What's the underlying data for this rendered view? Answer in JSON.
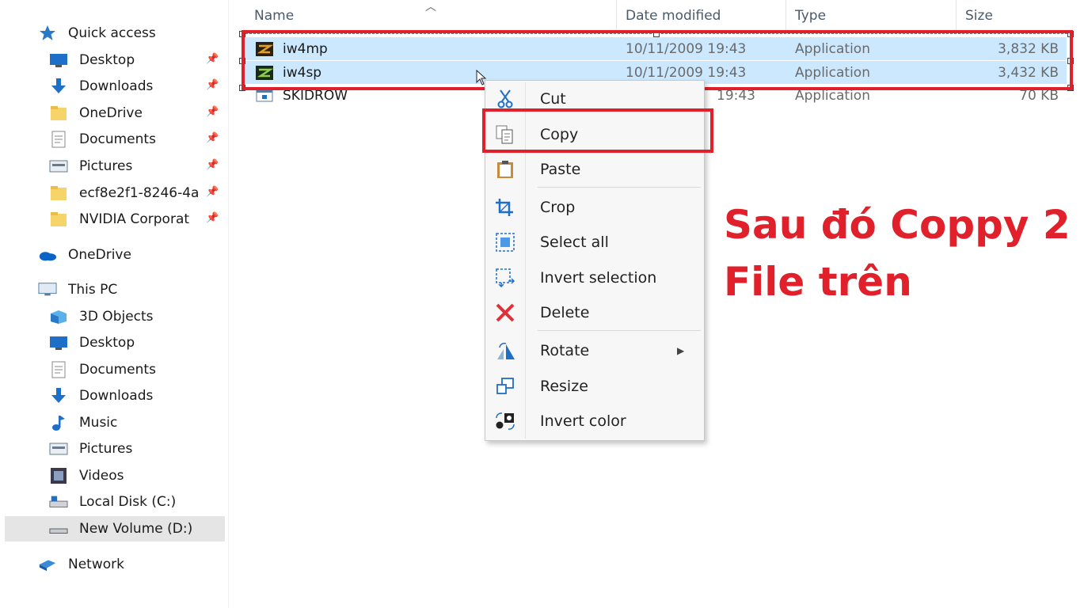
{
  "sidebar": {
    "quick_access": "Quick access",
    "items": [
      {
        "label": "Desktop",
        "icon": "desktop-icon",
        "pinned": true
      },
      {
        "label": "Downloads",
        "icon": "downloads-icon",
        "pinned": true
      },
      {
        "label": "OneDrive",
        "icon": "folder-icon",
        "pinned": true
      },
      {
        "label": "Documents",
        "icon": "documents-icon",
        "pinned": true
      },
      {
        "label": "Pictures",
        "icon": "pictures-icon",
        "pinned": true
      },
      {
        "label": "ecf8e2f1-8246-4a",
        "icon": "folder-icon",
        "pinned": true
      },
      {
        "label": "NVIDIA Corporat",
        "icon": "folder-icon",
        "pinned": true
      }
    ],
    "onedrive": "OneDrive",
    "this_pc": "This PC",
    "pc_items": [
      {
        "label": "3D Objects",
        "icon": "3d-objects-icon"
      },
      {
        "label": "Desktop",
        "icon": "desktop-icon"
      },
      {
        "label": "Documents",
        "icon": "documents-icon"
      },
      {
        "label": "Downloads",
        "icon": "downloads-icon"
      },
      {
        "label": "Music",
        "icon": "music-icon"
      },
      {
        "label": "Pictures",
        "icon": "pictures-icon"
      },
      {
        "label": "Videos",
        "icon": "videos-icon"
      },
      {
        "label": "Local Disk (C:)",
        "icon": "local-disk-icon"
      },
      {
        "label": "New Volume (D:)",
        "icon": "drive-icon"
      }
    ],
    "network": "Network"
  },
  "columns": {
    "name": "Name",
    "date": "Date modified",
    "type": "Type",
    "size": "Size"
  },
  "files": [
    {
      "name": "iw4mp",
      "date": "10/11/2009 19:43",
      "type": "Application",
      "size": "3,832 KB",
      "selected": true
    },
    {
      "name": "iw4sp",
      "date": "10/11/2009 19:43",
      "type": "Application",
      "size": "3,432 KB",
      "selected": true
    },
    {
      "name": "SKIDROW",
      "date": "19:43",
      "type": "Application",
      "size": "70 KB",
      "selected": false
    }
  ],
  "context_menu": {
    "items": [
      {
        "label": "Cut",
        "icon": "scissors-icon"
      },
      {
        "label": "Copy",
        "icon": "copy-icon"
      },
      {
        "label": "Paste",
        "icon": "clipboard-icon"
      },
      {
        "label": "Crop",
        "icon": "crop-icon"
      },
      {
        "label": "Select all",
        "icon": "select-all-icon"
      },
      {
        "label": "Invert selection",
        "icon": "invert-selection-icon"
      },
      {
        "label": "Delete",
        "icon": "delete-icon"
      },
      {
        "label": "Rotate",
        "icon": "rotate-icon"
      },
      {
        "label": "Resize",
        "icon": "resize-icon"
      },
      {
        "label": "Invert color",
        "icon": "invert-color-icon"
      }
    ]
  },
  "annotation": {
    "line1": "Sau đó Coppy 2",
    "line2": "File trên"
  },
  "colors": {
    "highlight_red": "#e0202a",
    "selection_blue": "#cce8ff",
    "accent_blue": "#0a64c8"
  }
}
